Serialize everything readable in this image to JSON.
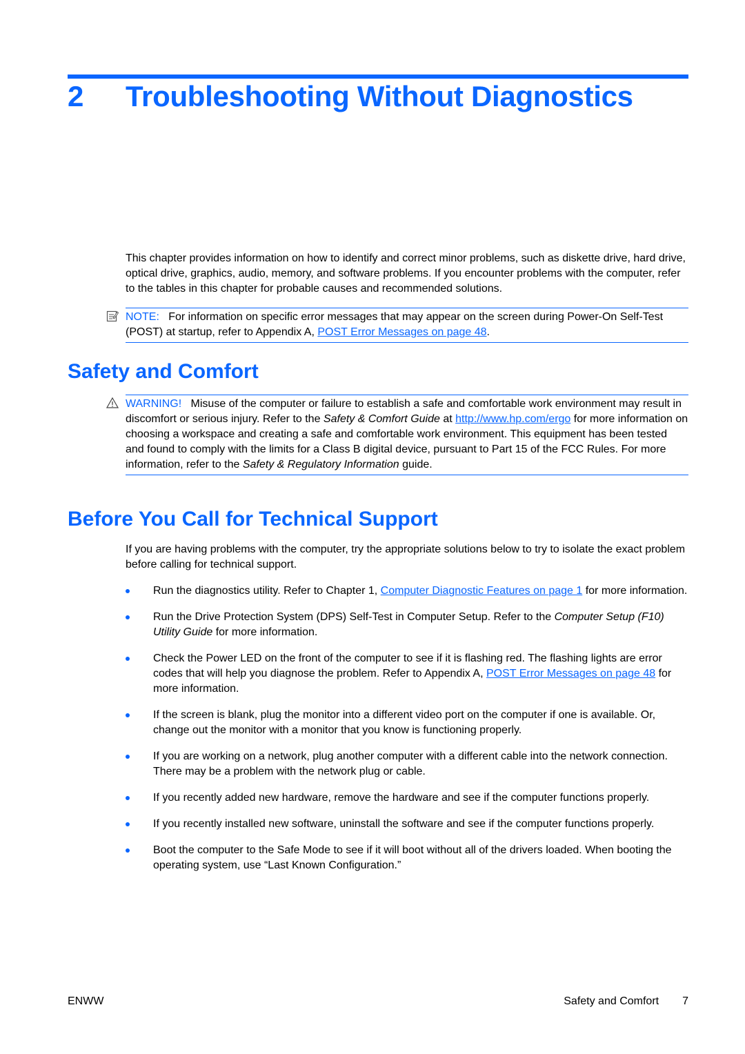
{
  "chapter": {
    "number": "2",
    "title": "Troubleshooting Without Diagnostics"
  },
  "intro": "This chapter provides information on how to identify and correct minor problems, such as diskette drive, hard drive, optical drive, graphics, audio, memory, and software problems. If you encounter problems with the computer, refer to the tables in this chapter for probable causes and recommended solutions.",
  "note": {
    "icon": "note-icon",
    "label": "NOTE:",
    "text_before": "For information on specific error messages that may appear on the screen during Power-On Self-Test (POST) at startup, refer to Appendix A, ",
    "link": "POST Error Messages on page 48",
    "text_after": "."
  },
  "safety_section": {
    "heading": "Safety and Comfort",
    "warning": {
      "icon": "warning-icon",
      "label": "WARNING!",
      "text1": "Misuse of the computer or failure to establish a safe and comfortable work environment may result in discomfort or serious injury. Refer to the ",
      "italic1": "Safety & Comfort Guide",
      "text2": " at ",
      "link": "http://www.hp.com/ergo",
      "text3": " for more information on choosing a workspace and creating a safe and comfortable work environment. This equipment has been tested and found to comply with the limits for a Class B digital device, pursuant to Part 15 of the FCC Rules. For more information, refer to the ",
      "italic2": "Safety & Regulatory Information",
      "text4": " guide."
    }
  },
  "support_section": {
    "heading": "Before You Call for Technical Support",
    "intro": "If you are having problems with the computer, try the appropriate solutions below to try to isolate the exact problem before calling for technical support.",
    "bullets": [
      {
        "before": "Run the diagnostics utility. Refer to Chapter 1, ",
        "link": "Computer Diagnostic Features on page 1",
        "after": " for more information."
      },
      {
        "before": "Run the Drive Protection System (DPS) Self-Test in Computer Setup. Refer to the ",
        "italic": "Computer Setup (F10) Utility Guide",
        "after": " for more information."
      },
      {
        "before": "Check the Power LED on the front of the computer to see if it is flashing red. The flashing lights are error codes that will help you diagnose the problem. Refer to Appendix A, ",
        "link": "POST Error Messages on page 48",
        "after": " for more information."
      },
      {
        "before": "If the screen is blank, plug the monitor into a different video port on the computer if one is available. Or, change out the monitor with a monitor that you know is functioning properly."
      },
      {
        "before": "If you are working on a network, plug another computer with a different cable into the network connection. There may be a problem with the network plug or cable."
      },
      {
        "before": "If you recently added new hardware, remove the hardware and see if the computer functions properly."
      },
      {
        "before": "If you recently installed new software, uninstall the software and see if the computer functions properly."
      },
      {
        "before": "Boot the computer to the Safe Mode to see if it will boot without all of the drivers loaded. When booting the operating system, use “Last Known Configuration.”"
      }
    ]
  },
  "footer": {
    "left": "ENWW",
    "section": "Safety and Comfort",
    "page": "7"
  }
}
